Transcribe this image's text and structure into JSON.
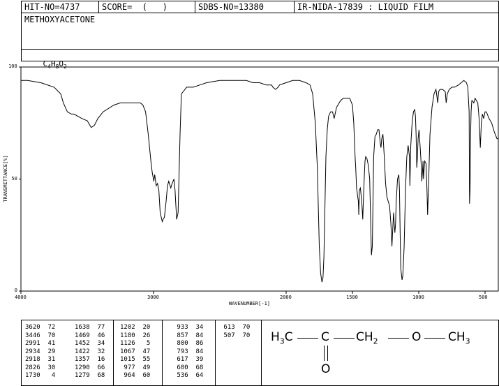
{
  "header": {
    "hit_no": "HIT-NO=4737",
    "score": "SCORE=  (   )",
    "sdbs_no": "SDBS-NO=13380",
    "ir_info": "IR-NIDA-17839 : LIQUID FILM",
    "compound_name": "METHOXYACETONE",
    "formula": {
      "c": "C",
      "c_n": "4",
      "h": "H",
      "h_n": "8",
      "o": "O",
      "o_n": "2"
    }
  },
  "chart_data": {
    "type": "line",
    "title": "",
    "xlabel": "WAVENUMBER[-1]",
    "ylabel": "TRANSMITTANCE[%]",
    "xlim": [
      4000,
      400
    ],
    "ylim": [
      0,
      100
    ],
    "x_ticks": [
      4000,
      3000,
      2000,
      1500,
      1000,
      500
    ],
    "x_tick_labels": [
      "4000",
      "3000",
      "2000",
      "1500",
      "1000",
      "500"
    ],
    "y_ticks": [
      0,
      50,
      100
    ],
    "y_tick_labels": [
      "0",
      "50",
      "100"
    ],
    "series": [
      {
        "points": [
          [
            4000,
            94
          ],
          [
            3950,
            94
          ],
          [
            3850,
            93
          ],
          [
            3750,
            91
          ],
          [
            3700,
            88
          ],
          [
            3680,
            84
          ],
          [
            3650,
            80
          ],
          [
            3620,
            79
          ],
          [
            3600,
            79
          ],
          [
            3540,
            77
          ],
          [
            3500,
            76
          ],
          [
            3470,
            73
          ],
          [
            3446,
            74
          ],
          [
            3420,
            77
          ],
          [
            3380,
            80
          ],
          [
            3300,
            83
          ],
          [
            3250,
            84
          ],
          [
            3200,
            84
          ],
          [
            3150,
            84
          ],
          [
            3100,
            84
          ],
          [
            3080,
            83
          ],
          [
            3060,
            80
          ],
          [
            3040,
            70
          ],
          [
            3020,
            58
          ],
          [
            3010,
            53
          ],
          [
            2998,
            49
          ],
          [
            2991,
            52
          ],
          [
            2980,
            47
          ],
          [
            2970,
            48
          ],
          [
            2960,
            45
          ],
          [
            2950,
            35
          ],
          [
            2934,
            31
          ],
          [
            2928,
            32
          ],
          [
            2918,
            33
          ],
          [
            2905,
            40
          ],
          [
            2895,
            47
          ],
          [
            2885,
            49
          ],
          [
            2870,
            46
          ],
          [
            2860,
            48
          ],
          [
            2846,
            50
          ],
          [
            2838,
            45
          ],
          [
            2826,
            32
          ],
          [
            2815,
            35
          ],
          [
            2800,
            70
          ],
          [
            2790,
            88
          ],
          [
            2750,
            91
          ],
          [
            2700,
            91
          ],
          [
            2650,
            92
          ],
          [
            2600,
            93
          ],
          [
            2500,
            94
          ],
          [
            2450,
            94
          ],
          [
            2400,
            94
          ],
          [
            2300,
            94
          ],
          [
            2250,
            93
          ],
          [
            2200,
            93
          ],
          [
            2150,
            92
          ],
          [
            2110,
            92
          ],
          [
            2100,
            91
          ],
          [
            2080,
            90
          ],
          [
            2060,
            91
          ],
          [
            2050,
            92
          ],
          [
            2000,
            93
          ],
          [
            1950,
            94
          ],
          [
            1920,
            94
          ],
          [
            1900,
            94
          ],
          [
            1850,
            93
          ],
          [
            1820,
            92
          ],
          [
            1800,
            88
          ],
          [
            1780,
            75
          ],
          [
            1765,
            55
          ],
          [
            1750,
            20
          ],
          [
            1740,
            8
          ],
          [
            1730,
            4
          ],
          [
            1722,
            6
          ],
          [
            1715,
            15
          ],
          [
            1710,
            30
          ],
          [
            1700,
            60
          ],
          [
            1690,
            72
          ],
          [
            1680,
            78
          ],
          [
            1665,
            80
          ],
          [
            1650,
            80
          ],
          [
            1638,
            77
          ],
          [
            1620,
            82
          ],
          [
            1590,
            85
          ],
          [
            1570,
            86
          ],
          [
            1540,
            86
          ],
          [
            1520,
            86
          ],
          [
            1500,
            83
          ],
          [
            1490,
            75
          ],
          [
            1480,
            60
          ],
          [
            1475,
            55
          ],
          [
            1469,
            46
          ],
          [
            1460,
            42
          ],
          [
            1455,
            40
          ],
          [
            1452,
            34
          ],
          [
            1448,
            45
          ],
          [
            1440,
            46
          ],
          [
            1430,
            40
          ],
          [
            1422,
            32
          ],
          [
            1418,
            40
          ],
          [
            1410,
            52
          ],
          [
            1405,
            58
          ],
          [
            1400,
            60
          ],
          [
            1390,
            59
          ],
          [
            1380,
            56
          ],
          [
            1370,
            50
          ],
          [
            1362,
            30
          ],
          [
            1357,
            16
          ],
          [
            1350,
            20
          ],
          [
            1340,
            60
          ],
          [
            1330,
            69
          ],
          [
            1320,
            70
          ],
          [
            1310,
            72
          ],
          [
            1300,
            72
          ],
          [
            1290,
            66
          ],
          [
            1285,
            64
          ],
          [
            1279,
            68
          ],
          [
            1270,
            70
          ],
          [
            1260,
            60
          ],
          [
            1250,
            48
          ],
          [
            1240,
            42
          ],
          [
            1230,
            40
          ],
          [
            1220,
            38
          ],
          [
            1210,
            30
          ],
          [
            1202,
            20
          ],
          [
            1196,
            28
          ],
          [
            1190,
            35
          ],
          [
            1185,
            30
          ],
          [
            1180,
            26
          ],
          [
            1175,
            30
          ],
          [
            1170,
            40
          ],
          [
            1160,
            50
          ],
          [
            1150,
            52
          ],
          [
            1145,
            45
          ],
          [
            1140,
            25
          ],
          [
            1135,
            10
          ],
          [
            1126,
            5
          ],
          [
            1120,
            7
          ],
          [
            1110,
            20
          ],
          [
            1100,
            45
          ],
          [
            1090,
            60
          ],
          [
            1080,
            65
          ],
          [
            1070,
            60
          ],
          [
            1067,
            47
          ],
          [
            1060,
            65
          ],
          [
            1050,
            75
          ],
          [
            1040,
            80
          ],
          [
            1030,
            81
          ],
          [
            1025,
            78
          ],
          [
            1020,
            70
          ],
          [
            1015,
            55
          ],
          [
            1010,
            60
          ],
          [
            1005,
            68
          ],
          [
            998,
            72
          ],
          [
            990,
            65
          ],
          [
            980,
            55
          ],
          [
            977,
            49
          ],
          [
            970,
            55
          ],
          [
            968,
            58
          ],
          [
            964,
            50
          ],
          [
            955,
            58
          ],
          [
            945,
            57
          ],
          [
            938,
            45
          ],
          [
            933,
            34
          ],
          [
            925,
            50
          ],
          [
            915,
            70
          ],
          [
            900,
            82
          ],
          [
            885,
            88
          ],
          [
            870,
            90
          ],
          [
            857,
            84
          ],
          [
            850,
            89
          ],
          [
            840,
            90
          ],
          [
            820,
            90
          ],
          [
            800,
            89
          ],
          [
            793,
            84
          ],
          [
            785,
            88
          ],
          [
            770,
            90
          ],
          [
            750,
            91
          ],
          [
            730,
            91
          ],
          [
            700,
            92
          ],
          [
            680,
            93
          ],
          [
            660,
            94
          ],
          [
            640,
            93
          ],
          [
            630,
            91
          ],
          [
            620,
            80
          ],
          [
            617,
            39
          ],
          [
            613,
            45
          ],
          [
            609,
            70
          ],
          [
            605,
            80
          ],
          [
            600,
            85
          ],
          [
            595,
            85
          ],
          [
            585,
            84
          ],
          [
            575,
            86
          ],
          [
            565,
            85
          ],
          [
            555,
            84
          ],
          [
            545,
            77
          ],
          [
            536,
            64
          ],
          [
            528,
            75
          ],
          [
            520,
            79
          ],
          [
            510,
            77
          ],
          [
            500,
            80
          ],
          [
            490,
            80
          ],
          [
            470,
            77
          ],
          [
            450,
            75
          ],
          [
            430,
            71
          ],
          [
            410,
            68
          ],
          [
            400,
            68
          ]
        ]
      }
    ],
    "peaks": [
      [
        3620,
        72
      ],
      [
        3446,
        70
      ],
      [
        2991,
        41
      ],
      [
        2934,
        29
      ],
      [
        2918,
        31
      ],
      [
        2826,
        30
      ],
      [
        1730,
        4
      ],
      [
        1638,
        77
      ],
      [
        1469,
        46
      ],
      [
        1452,
        34
      ],
      [
        1422,
        32
      ],
      [
        1357,
        16
      ],
      [
        1290,
        66
      ],
      [
        1279,
        68
      ],
      [
        1202,
        20
      ],
      [
        1180,
        26
      ],
      [
        1126,
        5
      ],
      [
        1067,
        47
      ],
      [
        1015,
        55
      ],
      [
        977,
        49
      ],
      [
        964,
        60
      ],
      [
        933,
        34
      ],
      [
        857,
        84
      ],
      [
        800,
        86
      ],
      [
        793,
        84
      ],
      [
        617,
        39
      ],
      [
        600,
        68
      ],
      [
        536,
        64
      ],
      [
        613,
        70
      ],
      [
        507,
        70
      ]
    ]
  },
  "peak_table": {
    "columns": [
      [
        "3620  72",
        "3446  70",
        "2991  41",
        "2934  29",
        "2918  31",
        "2826  30",
        "1730   4"
      ],
      [
        "1638  77",
        "1469  46",
        "1452  34",
        "1422  32",
        "1357  16",
        "1290  66",
        "1279  68"
      ],
      [
        "1202  20",
        "1180  26",
        "1126   5",
        "1067  47",
        "1015  55",
        " 977  49",
        " 964  60"
      ],
      [
        " 933  34",
        " 857  84",
        " 800  86",
        " 793  84",
        " 617  39",
        " 600  68",
        " 536  64"
      ],
      [
        " 613  70",
        " 507  70"
      ]
    ]
  },
  "structure": {
    "h3c_h": "H",
    "h3c_n": "3",
    "h3c_c": "C",
    "carbonyl_c": "C",
    "ch2_ch": "CH",
    "ch2_n": "2",
    "oxygen": "O",
    "ch3": "CH",
    "ch3_n": "3",
    "carbonyl_o": "O"
  }
}
